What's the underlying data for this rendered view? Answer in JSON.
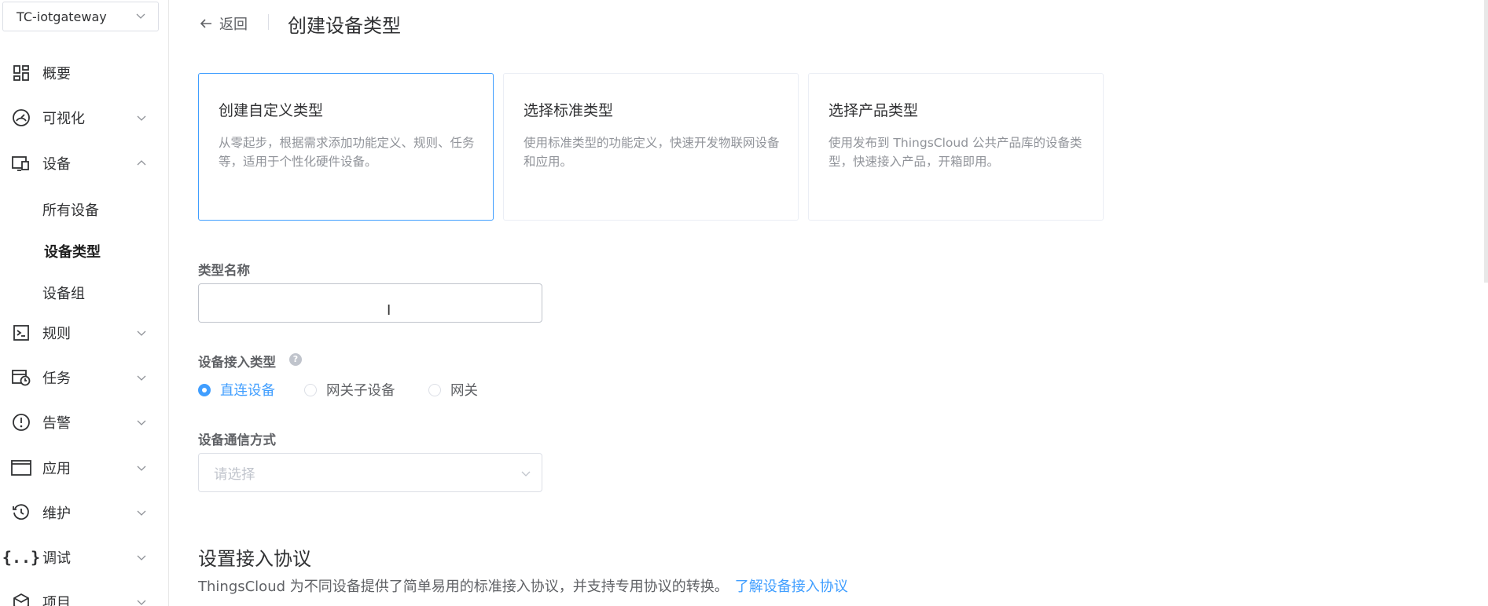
{
  "sidebar": {
    "org_name": "TC-iotgateway",
    "items": [
      {
        "label": "概要",
        "icon": "dashboard-icon",
        "expandable": false
      },
      {
        "label": "可视化",
        "icon": "gauge-icon",
        "expandable": true
      },
      {
        "label": "设备",
        "icon": "devices-icon",
        "expandable": true,
        "expanded": true
      },
      {
        "label": "规则",
        "icon": "terminal-icon",
        "expandable": true
      },
      {
        "label": "任务",
        "icon": "calendar-clock-icon",
        "expandable": true
      },
      {
        "label": "告警",
        "icon": "alert-icon",
        "expandable": true
      },
      {
        "label": "应用",
        "icon": "window-icon",
        "expandable": true
      },
      {
        "label": "维护",
        "icon": "history-icon",
        "expandable": true
      },
      {
        "label": "调试",
        "icon": "braces-icon",
        "expandable": true
      },
      {
        "label": "项目",
        "icon": "box-icon",
        "expandable": true
      }
    ],
    "device_sub": [
      "所有设备",
      "设备类型",
      "设备组"
    ],
    "active_sub": "设备类型"
  },
  "header": {
    "back_label": "返回",
    "title": "创建设备类型"
  },
  "cards": [
    {
      "title": "创建自定义类型",
      "desc": "从零起步，根据需求添加功能定义、规则、任务等，适用于个性化硬件设备。",
      "selected": true
    },
    {
      "title": "选择标准类型",
      "desc": "使用标准类型的功能定义，快速开发物联网设备和应用。",
      "selected": false
    },
    {
      "title": "选择产品类型",
      "desc": "使用发布到 ThingsCloud 公共产品库的设备类型，快速接入产品，开箱即用。",
      "selected": false
    }
  ],
  "form": {
    "type_name_label": "类型名称",
    "type_name_value": "",
    "access_type_label": "设备接入类型",
    "access_options": [
      "直连设备",
      "网关子设备",
      "网关"
    ],
    "access_selected": "直连设备",
    "comm_label": "设备通信方式",
    "comm_placeholder": "请选择"
  },
  "protocol": {
    "title": "设置接入协议",
    "desc": "ThingsCloud 为不同设备提供了简单易用的标准接入协议，并支持专用协议的转换。",
    "link": "了解设备接入协议"
  },
  "colors": {
    "accent": "#409eff",
    "text": "#303133",
    "muted": "#909399"
  }
}
